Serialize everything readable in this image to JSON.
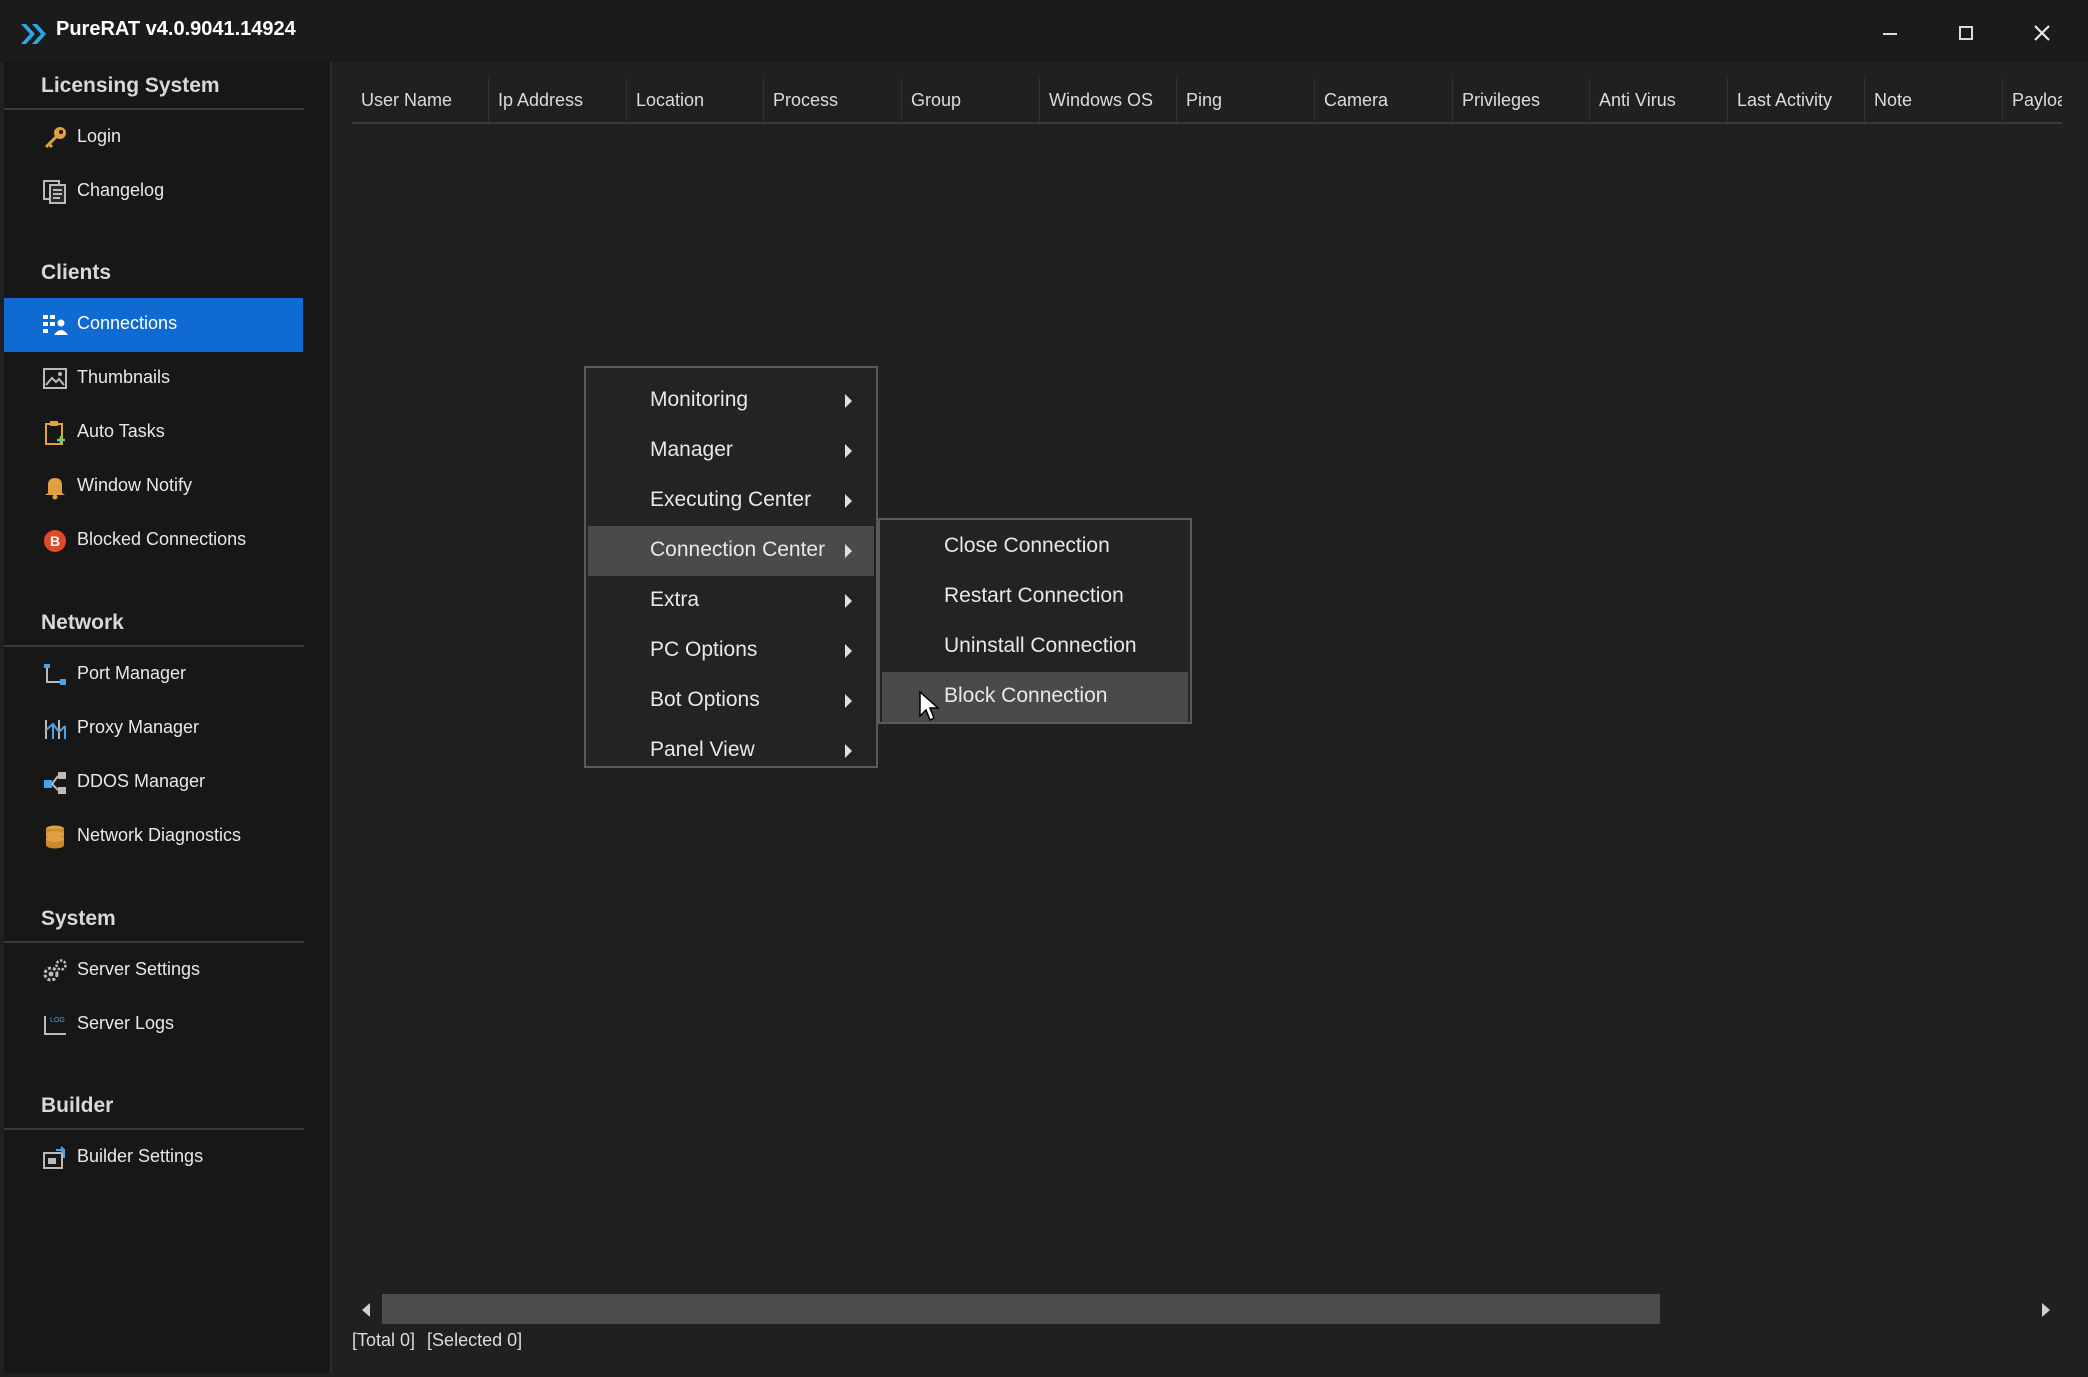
{
  "window": {
    "title": "PureRAT v4.0.9041.14924",
    "minimize_icon": "minimize-icon",
    "maximize_icon": "maximize-icon",
    "close_icon": "close-icon"
  },
  "sidebar": {
    "sections": [
      {
        "title": "Licensing System",
        "items": [
          {
            "label": "Login",
            "icon": "key-icon"
          },
          {
            "label": "Changelog",
            "icon": "changelog-icon"
          }
        ]
      },
      {
        "title": "Clients",
        "items": [
          {
            "label": "Connections",
            "icon": "connections-icon",
            "active": true
          },
          {
            "label": "Thumbnails",
            "icon": "thumbnails-icon"
          },
          {
            "label": "Auto Tasks",
            "icon": "clipboard-icon"
          },
          {
            "label": "Window Notify",
            "icon": "bell-icon"
          },
          {
            "label": "Blocked Connections",
            "icon": "blocked-icon"
          }
        ]
      },
      {
        "title": "Network",
        "items": [
          {
            "label": "Port Manager",
            "icon": "port-icon"
          },
          {
            "label": "Proxy Manager",
            "icon": "proxy-icon"
          },
          {
            "label": "DDOS Manager",
            "icon": "ddos-icon"
          },
          {
            "label": "Network Diagnostics",
            "icon": "database-icon"
          }
        ]
      },
      {
        "title": "System",
        "items": [
          {
            "label": "Server Settings",
            "icon": "gears-icon"
          },
          {
            "label": "Server Logs",
            "icon": "log-icon"
          }
        ]
      },
      {
        "title": "Builder",
        "items": [
          {
            "label": "Builder Settings",
            "icon": "builder-icon"
          }
        ]
      }
    ]
  },
  "table": {
    "columns": [
      "User Name",
      "Ip Address",
      "Location",
      "Process",
      "Group",
      "Windows OS",
      "Ping",
      "Camera",
      "Privileges",
      "Anti Virus",
      "Last Activity",
      "Note",
      "Payload"
    ],
    "rows": []
  },
  "context_menu": {
    "items": [
      "Monitoring",
      "Manager",
      "Executing Center",
      "Connection Center",
      "Extra",
      "PC Options",
      "Bot Options",
      "Panel View"
    ],
    "highlighted": "Connection Center",
    "submenu": {
      "items": [
        "Close Connection",
        "Restart Connection",
        "Uninstall Connection",
        "Block Connection"
      ],
      "highlighted": "Block Connection"
    }
  },
  "status": {
    "total": "[Total 0]",
    "selected": "[Selected 0]"
  },
  "colors": {
    "accent": "#0f6bd2",
    "background": "#202020",
    "sidebar": "#171717",
    "highlight": "#4a4a4a"
  }
}
